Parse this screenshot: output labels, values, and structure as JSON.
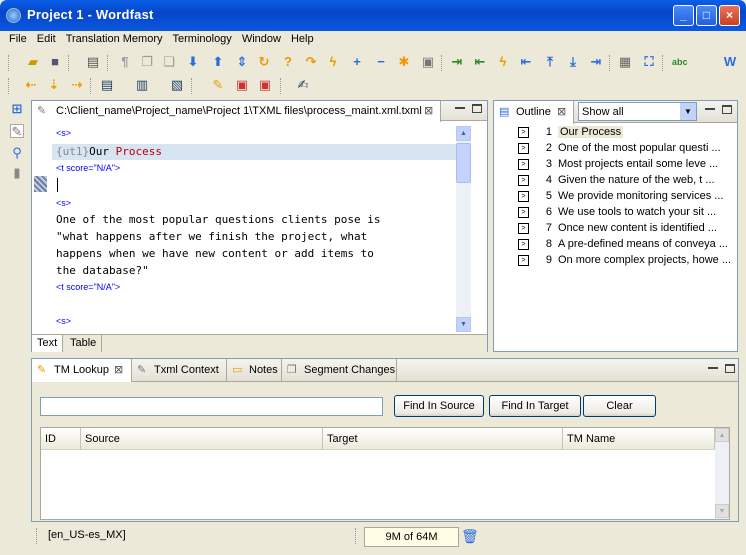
{
  "window": {
    "title": "Project 1 - Wordfast",
    "min": "_",
    "max": "□",
    "close": "×"
  },
  "menu": [
    "File",
    "Edit",
    "Translation Memory",
    "Terminology",
    "Window",
    "Help"
  ],
  "editor": {
    "tab_title": "C:\\Client_name\\Project_name\\Project 1\\TXML files\\process_maint.xml.txml",
    "lines": [
      {
        "kind": "tag",
        "text": "<s>"
      },
      {
        "kind": "seg1",
        "prefix": "{ut1}",
        "word1": "Our",
        "word2": "Process"
      },
      {
        "kind": "tag",
        "text": "<t score=\"N/A\">"
      },
      {
        "kind": "cursor",
        "text": ""
      },
      {
        "kind": "tag",
        "text": "<s>"
      },
      {
        "kind": "text",
        "text": "One of the most popular questions clients pose is"
      },
      {
        "kind": "text",
        "text": "\"what happens after we finish the project, what"
      },
      {
        "kind": "text",
        "text": "happens when we have new content or add items to"
      },
      {
        "kind": "text",
        "text": "the database?\""
      },
      {
        "kind": "tag",
        "text": "<t score=\"N/A\">"
      },
      {
        "kind": "tag",
        "text": "<s>"
      }
    ],
    "view_tabs": [
      "Text",
      "Table"
    ]
  },
  "outline": {
    "tab": "Outline",
    "filter": "Show all",
    "items": [
      {
        "num": "1",
        "text": "Our Process"
      },
      {
        "num": "2",
        "text": "One of the most popular questi ..."
      },
      {
        "num": "3",
        "text": "Most projects entail some leve ..."
      },
      {
        "num": "4",
        "text": "Given the nature of the web, t ..."
      },
      {
        "num": "5",
        "text": "We provide monitoring services ..."
      },
      {
        "num": "6",
        "text": "We use tools to watch your sit ..."
      },
      {
        "num": "7",
        "text": "Once new content is identified ..."
      },
      {
        "num": "8",
        "text": "A pre-defined means of conveya ..."
      },
      {
        "num": "9",
        "text": "On more complex projects, howe ..."
      }
    ]
  },
  "bottom": {
    "tabs": [
      "TM Lookup",
      "Txml Context",
      "Notes",
      "Segment Changes"
    ],
    "search_value": "",
    "buttons": {
      "find_source": "Find In Source",
      "find_target": "Find In Target",
      "clear": "Clear"
    },
    "columns": [
      "ID",
      "Source",
      "Target",
      "TM Name"
    ]
  },
  "status": {
    "lang": "[en_US-es_MX]",
    "memory": "9M of 64M"
  }
}
